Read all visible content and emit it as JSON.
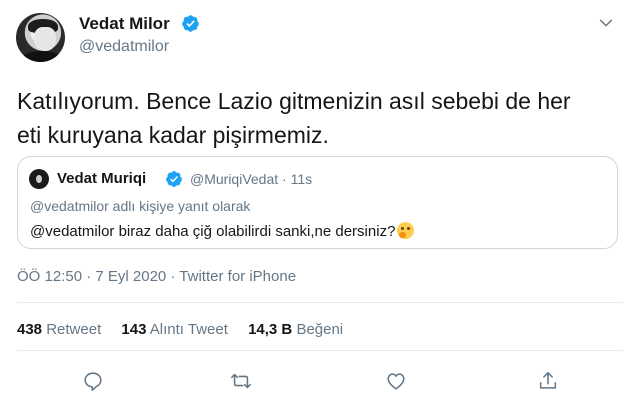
{
  "author": {
    "name": "Vedat Milor",
    "handle": "@vedatmilor",
    "verified_icon": "verified-badge-icon"
  },
  "tweet": {
    "line1": "Katılıyorum. Bence Lazio gitmenizin asıl sebebi de her",
    "line2": "eti kuruyana kadar pişirmemiz."
  },
  "quoted": {
    "name": "Vedat Muriqi",
    "handle_time": "@MuriqiVedat · 11s",
    "reply_context": "@vedatmilor adlı kişiye yanıt olarak",
    "text": "@vedatmilor biraz daha çiğ olabilirdi sanki,ne dersiniz?",
    "emoji": "thinking-face-emoji"
  },
  "meta": "ÖÖ 12:50 · 7 Eyl 2020 · Twitter for iPhone",
  "stats": {
    "retweets_count": "438",
    "retweets_label": "Retweet",
    "quotes_count": "143",
    "quotes_label": "Alıntı Tweet",
    "likes_count": "14,3 B",
    "likes_label": "Beğeni"
  },
  "colors": {
    "accent": "#1da1f2",
    "secondary_text": "#657786",
    "border": "#ccd6dd"
  }
}
